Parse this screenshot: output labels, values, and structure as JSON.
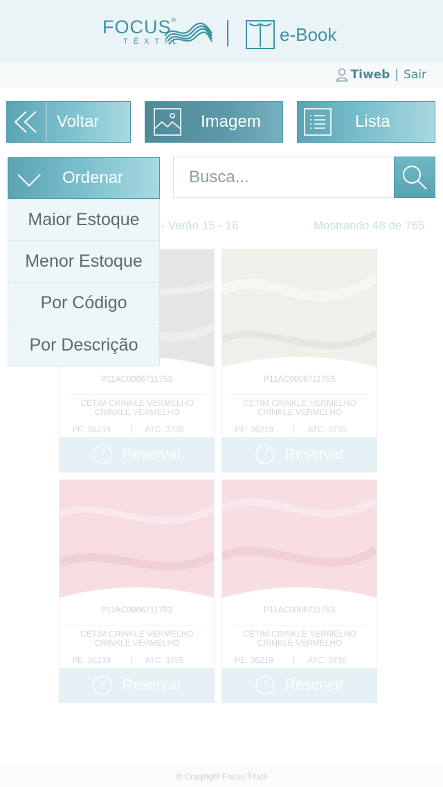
{
  "header": {
    "brand_name": "FOCUS",
    "brand_sub": "TÊXTIL",
    "app_name": "e-Book"
  },
  "userbar": {
    "username": "Tiweb",
    "separator": "|",
    "logout": "Sair"
  },
  "toolbar": {
    "back_label": "Voltar",
    "image_label": "Imagem",
    "list_label": "Lista",
    "sort_label": "Ordenar"
  },
  "search": {
    "placeholder": "Busca..."
  },
  "sort_menu": [
    "Maior Estoque",
    "Menor Estoque",
    "Por Código",
    "Por Descrição"
  ],
  "catalog": {
    "collection": "Express - Verão 15 - 16",
    "showing": "Mostrando 48 de 765"
  },
  "products": [
    {
      "code": "P11AC0006711753",
      "desc_line1": "CETIM CRINKLE VERMELHO",
      "desc_line2": "CRINKLE VERMELHO",
      "pe": "PE: 36219",
      "atc": "ATC: 3735",
      "reserve": "Reservar",
      "color": "#e4e5e5"
    },
    {
      "code": "P11AC0006711753",
      "desc_line1": "CETIM CRINKLE VERMELHO",
      "desc_line2": "CRINKLE VERMELHO",
      "pe": "PE: 36219",
      "atc": "ATC: 3735",
      "reserve": "Reservar",
      "color": "#eef0ea"
    },
    {
      "code": "P11AC0006711753",
      "desc_line1": "CETIM CRINKLE VERMELHO",
      "desc_line2": "CRINKLE VERMELHO",
      "pe": "PE: 36219",
      "atc": "ATC: 3735",
      "reserve": "Reservar",
      "color": "#f6dde2"
    },
    {
      "code": "P11AC0006711753",
      "desc_line1": "CETIM CRINKLE VERMELHO",
      "desc_line2": "CRINKLE VERMELHO",
      "pe": "PE: 36219",
      "atc": "ATC: 3735",
      "reserve": "Reservar",
      "color": "#f7dee3"
    }
  ],
  "footer": {
    "copyright": "© Copyright Focus Têxtil"
  },
  "colors": {
    "accent": "#5aa3b3",
    "accent_dark": "#4f8a99",
    "header_bg": "#eaf4f6"
  }
}
